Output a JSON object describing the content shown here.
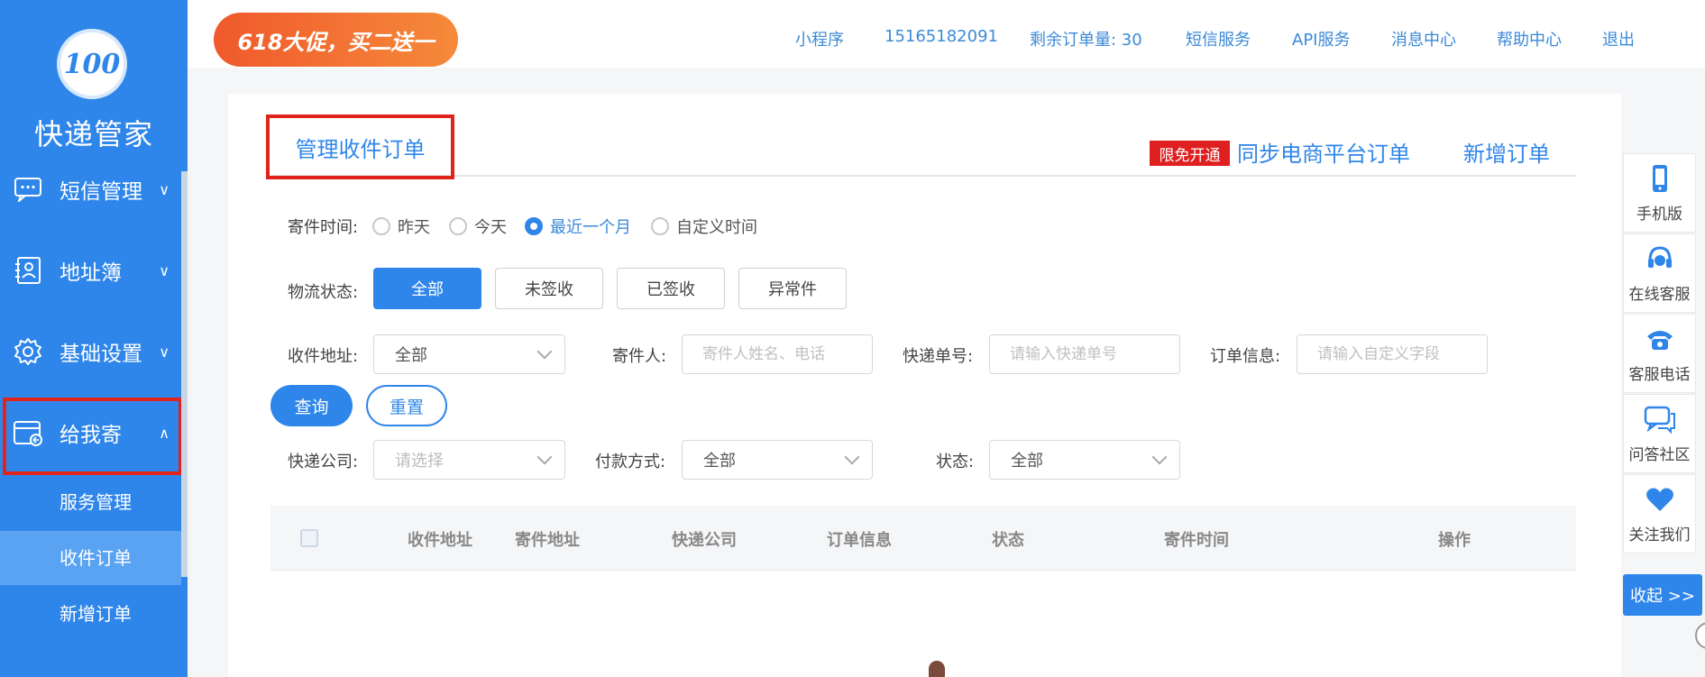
{
  "app": {
    "logo_badge": "100",
    "logo_sub": "管家",
    "name": "快递管家"
  },
  "colors": {
    "accent": "#2f86ea",
    "highlight_border": "#e0231b",
    "badge_red": "#e02020",
    "sidebar_active": "#5aa3f2"
  },
  "promo": {
    "text": "618大促，买二送一"
  },
  "topnav": {
    "mini_program": "小程序",
    "phone": "15165182091",
    "remaining_orders": "剩余订单量: 30",
    "sms_service": "短信服务",
    "api_service": "API服务",
    "message_center": "消息中心",
    "help_center": "帮助中心",
    "logout": "退出"
  },
  "sidebar": {
    "items": [
      {
        "label": "短信管理",
        "icon": "chat-icon",
        "chevron": "down"
      },
      {
        "label": "地址簿",
        "icon": "contact-book-icon",
        "chevron": "down"
      },
      {
        "label": "基础设置",
        "icon": "gear-icon",
        "chevron": "down"
      },
      {
        "label": "给我寄",
        "icon": "parcel-return-icon",
        "chevron": "up",
        "highlighted": true
      }
    ],
    "sub_items": [
      {
        "label": "服务管理",
        "active": false
      },
      {
        "label": "收件订单",
        "active": true
      },
      {
        "label": "新增订单",
        "active": false
      }
    ]
  },
  "tabs": {
    "main": "管理收件订单",
    "free_badge": "限免开通",
    "sync": "同步电商平台订单",
    "new_order": "新增订单"
  },
  "filters": {
    "send_time": {
      "label": "寄件时间:",
      "options": [
        "昨天",
        "今天",
        "最近一个月",
        "自定义时间"
      ],
      "selected": "最近一个月"
    },
    "logistics_status": {
      "label": "物流状态:",
      "options": [
        "全部",
        "未签收",
        "已签收",
        "异常件"
      ],
      "selected": "全部"
    },
    "recv_address": {
      "label": "收件地址:",
      "value": "全部"
    },
    "sender": {
      "label": "寄件人:",
      "placeholder": "寄件人姓名、电话"
    },
    "tracking_no": {
      "label": "快递单号:",
      "placeholder": "请输入快递单号"
    },
    "order_info": {
      "label": "订单信息:",
      "placeholder": "请输入自定义字段"
    },
    "courier": {
      "label": "快递公司:",
      "value": "请选择"
    },
    "payment": {
      "label": "付款方式:",
      "value": "全部"
    },
    "status": {
      "label": "状态:",
      "value": "全部"
    },
    "query_button": "查询",
    "reset_button": "重置"
  },
  "table": {
    "columns": [
      "收件地址",
      "寄件地址",
      "快递公司",
      "订单信息",
      "状态",
      "寄件时间",
      "操作"
    ]
  },
  "right_panel": {
    "items": [
      {
        "label": "手机版",
        "icon": "mobile-phone-icon"
      },
      {
        "label": "在线客服",
        "icon": "headset-icon"
      },
      {
        "label": "客服电话",
        "icon": "telephone-icon"
      },
      {
        "label": "问答社区",
        "icon": "chat-bubbles-icon"
      },
      {
        "label": "关注我们",
        "icon": "heart-icon"
      }
    ],
    "collapse": "收起 >>"
  }
}
